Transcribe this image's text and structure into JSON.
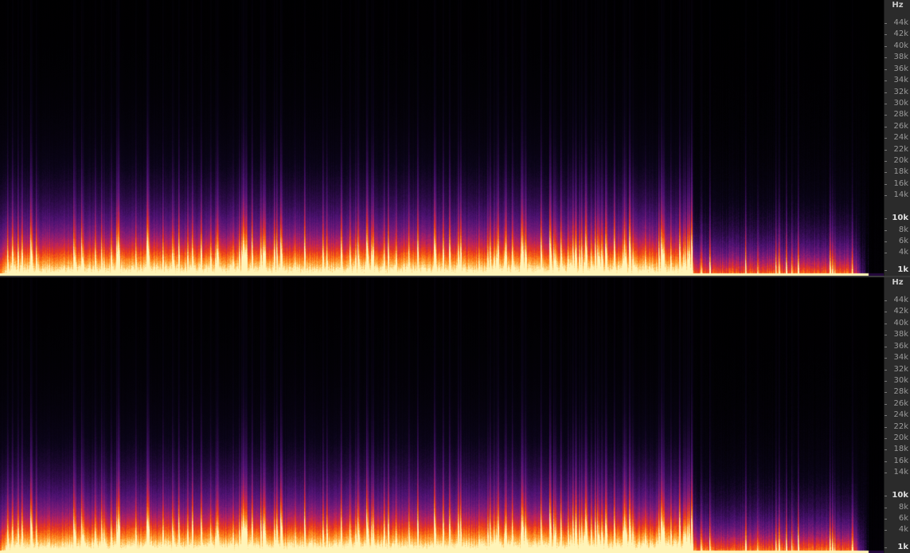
{
  "view": {
    "colormap": [
      "#000000",
      "#0a0418",
      "#2a0a45",
      "#4d1272",
      "#7a1a78",
      "#b8215e",
      "#e8361e",
      "#fb7412",
      "#fdb34a",
      "#fff4b8"
    ]
  },
  "channels": [
    {
      "id": "top",
      "ruler": {
        "unit": "Hz",
        "ticks": [
          {
            "label": "44k",
            "hz": 44000,
            "major": false
          },
          {
            "label": "42k",
            "hz": 42000,
            "major": false
          },
          {
            "label": "40k",
            "hz": 40000,
            "major": false
          },
          {
            "label": "38k",
            "hz": 38000,
            "major": false
          },
          {
            "label": "36k",
            "hz": 36000,
            "major": false
          },
          {
            "label": "34k",
            "hz": 34000,
            "major": false
          },
          {
            "label": "32k",
            "hz": 32000,
            "major": false
          },
          {
            "label": "30k",
            "hz": 30000,
            "major": false
          },
          {
            "label": "28k",
            "hz": 28000,
            "major": false
          },
          {
            "label": "26k",
            "hz": 26000,
            "major": false
          },
          {
            "label": "24k",
            "hz": 24000,
            "major": false
          },
          {
            "label": "22k",
            "hz": 22000,
            "major": false
          },
          {
            "label": "20k",
            "hz": 20000,
            "major": false
          },
          {
            "label": "18k",
            "hz": 18000,
            "major": false
          },
          {
            "label": "16k",
            "hz": 16000,
            "major": false
          },
          {
            "label": "14k",
            "hz": 14000,
            "major": false
          },
          {
            "label": "10k",
            "hz": 10000,
            "major": true
          },
          {
            "label": "8k",
            "hz": 8000,
            "major": false
          },
          {
            "label": "6k",
            "hz": 6000,
            "major": false
          },
          {
            "label": "4k",
            "hz": 4000,
            "major": false
          },
          {
            "label": "1k",
            "hz": 1000,
            "major": true
          }
        ]
      }
    },
    {
      "id": "bottom",
      "ruler": {
        "unit": "Hz",
        "ticks": [
          {
            "label": "44k",
            "hz": 44000,
            "major": false
          },
          {
            "label": "42k",
            "hz": 42000,
            "major": false
          },
          {
            "label": "40k",
            "hz": 40000,
            "major": false
          },
          {
            "label": "38k",
            "hz": 38000,
            "major": false
          },
          {
            "label": "36k",
            "hz": 36000,
            "major": false
          },
          {
            "label": "34k",
            "hz": 34000,
            "major": false
          },
          {
            "label": "32k",
            "hz": 32000,
            "major": false
          },
          {
            "label": "30k",
            "hz": 30000,
            "major": false
          },
          {
            "label": "28k",
            "hz": 28000,
            "major": false
          },
          {
            "label": "26k",
            "hz": 26000,
            "major": false
          },
          {
            "label": "24k",
            "hz": 24000,
            "major": false
          },
          {
            "label": "22k",
            "hz": 22000,
            "major": false
          },
          {
            "label": "20k",
            "hz": 20000,
            "major": false
          },
          {
            "label": "18k",
            "hz": 18000,
            "major": false
          },
          {
            "label": "16k",
            "hz": 16000,
            "major": false
          },
          {
            "label": "14k",
            "hz": 14000,
            "major": false
          },
          {
            "label": "10k",
            "hz": 10000,
            "major": true
          },
          {
            "label": "8k",
            "hz": 8000,
            "major": false
          },
          {
            "label": "6k",
            "hz": 6000,
            "major": false
          },
          {
            "label": "4k",
            "hz": 4000,
            "major": false
          },
          {
            "label": "1k",
            "hz": 1000,
            "major": true
          }
        ]
      }
    }
  ]
}
